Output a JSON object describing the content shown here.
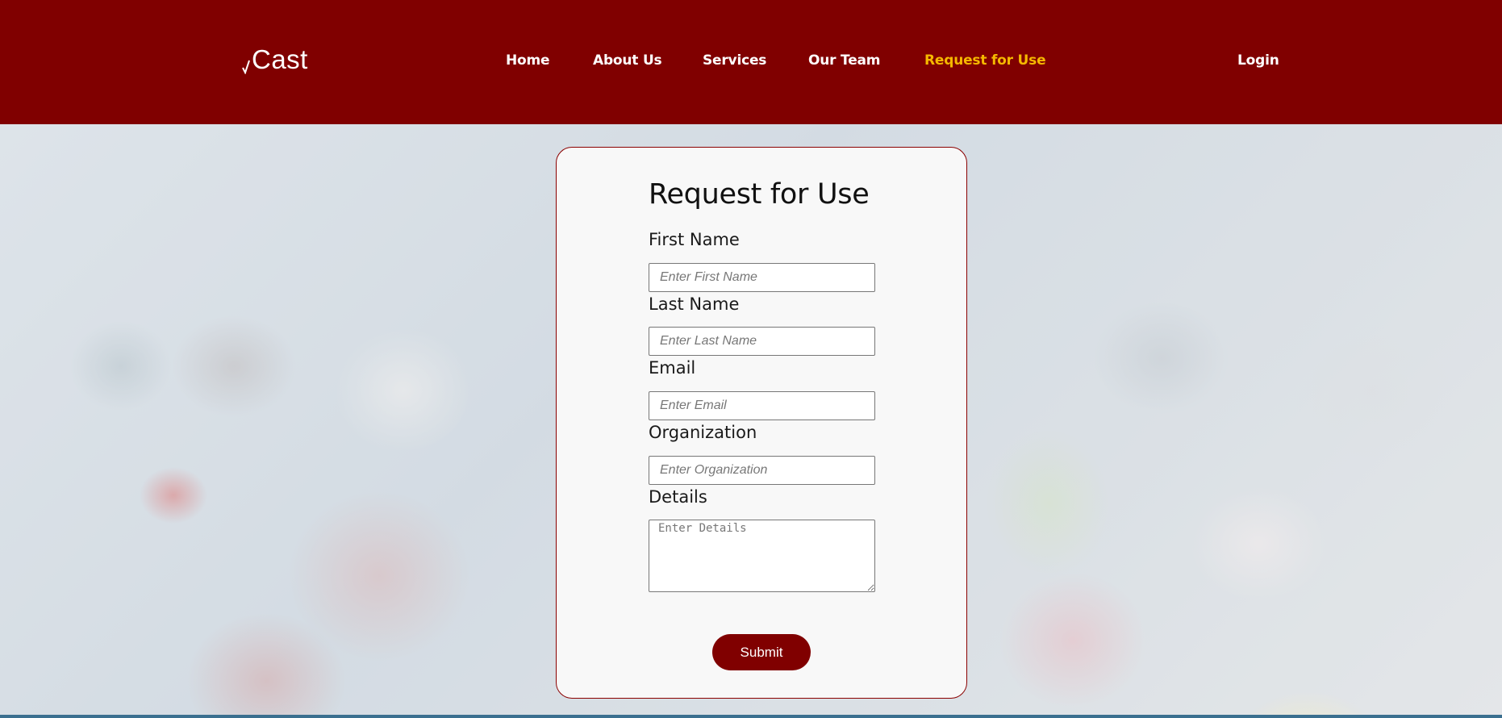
{
  "brand": {
    "name": "Cast"
  },
  "nav": {
    "items": [
      {
        "label": "Home"
      },
      {
        "label": "About Us"
      },
      {
        "label": "Services"
      },
      {
        "label": "Our Team"
      },
      {
        "label": "Request for Use",
        "active": true
      }
    ],
    "login_label": "Login"
  },
  "form": {
    "title": "Request for Use",
    "fields": [
      {
        "label": "First Name",
        "placeholder": "Enter First Name",
        "value": ""
      },
      {
        "label": "Last Name",
        "placeholder": "Enter Last Name",
        "value": ""
      },
      {
        "label": "Email",
        "placeholder": "Enter Email",
        "value": ""
      },
      {
        "label": "Organization",
        "placeholder": "Enter Organization",
        "value": ""
      },
      {
        "label": "Details",
        "placeholder": "Enter Details",
        "value": ""
      }
    ],
    "submit_label": "Submit"
  },
  "colors": {
    "header_bg": "#800000",
    "active_nav": "#f5b800",
    "button_bg": "#800000",
    "card_bg": "#f8f8f8"
  },
  "icons": {
    "logo_mark": "check-mark-icon"
  }
}
